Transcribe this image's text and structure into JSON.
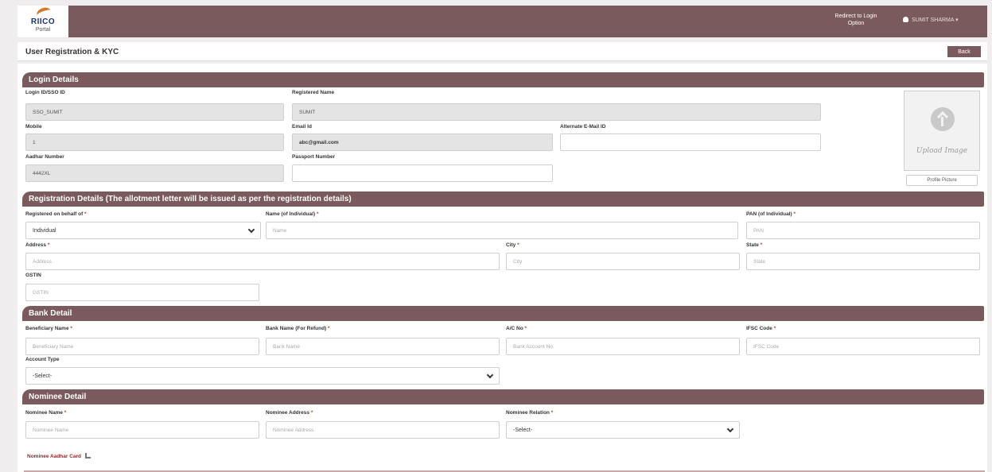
{
  "app": {
    "logo_brand": "RIICO",
    "logo_sub": "Portal",
    "redirect_label": "Redirect to Login Option",
    "user_name": "SUMIT SHARMA",
    "user_caret": "▾"
  },
  "header": {
    "title": "User Registration & KYC",
    "back_label": "Back"
  },
  "login_details": {
    "section_title": "Login Details",
    "login_id_label": "Login ID/SSO ID",
    "login_id_value": "SSO_SUMIT",
    "registered_name_label": "Registered Name",
    "registered_name_value": "SUMIT",
    "mobile_label": "Mobile",
    "mobile_value": "1",
    "email_label": "Email Id",
    "email_value": "abc@gmail.com",
    "alt_email_label": "Alternate E-Mail ID",
    "alt_email_value": "",
    "aadhar_label": "Aadhar Number",
    "aadhar_value": "4442XL",
    "passport_label": "Passport Number",
    "passport_value": "",
    "upload_image_label": "Upload Image",
    "profile_picture_label": "Profile Picture"
  },
  "registration_details": {
    "section_title": "Registration Details (The allotment letter will be issued as per the registration details)",
    "behalf_label": "Registered on behalf of",
    "behalf_value": "Individual",
    "name_label": "Name (of Individual)",
    "name_placeholder": "Name",
    "pan_label": "PAN (of Individual)",
    "pan_placeholder": "PAN",
    "address_label": "Address",
    "address_placeholder": "Address",
    "city_label": "City",
    "city_placeholder": "City",
    "state_label": "State",
    "state_placeholder": "State",
    "gstin_label": "GSTIN",
    "gstin_placeholder": "GSTIN",
    "required_mark": "*"
  },
  "bank_detail": {
    "section_title": "Bank Detail",
    "beneficiary_label": "Beneficiary Name",
    "beneficiary_placeholder": "Beneficiary Name",
    "bank_name_label": "Bank Name (For Refund)",
    "bank_name_placeholder": "Bank Name",
    "ac_no_label": "A/C No",
    "ac_no_placeholder": "Bank Account No.",
    "ifsc_label": "IFSC Code",
    "ifsc_placeholder": "IFSC Code",
    "account_type_label": "Account Type",
    "account_type_value": "-Select-"
  },
  "nominee_detail": {
    "section_title": "Nominee Detail",
    "nominee_name_label": "Nominee Name",
    "nominee_name_placeholder": "Nominee Name",
    "nominee_address_label": "Nominee Address",
    "nominee_address_placeholder": "Nominee Address",
    "nominee_relation_label": "Nominee Relation",
    "nominee_relation_value": "-Select-",
    "nominee_aadhar_label": "Nominee Aadhar Card"
  },
  "colors": {
    "brand": "#7a5a5c",
    "accent_orange": "#d27a2a",
    "required": "#c0392b"
  }
}
